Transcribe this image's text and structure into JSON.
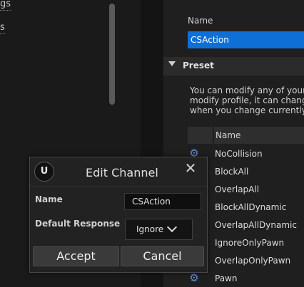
{
  "left_panel": {
    "items": [
      "gs",
      "s"
    ]
  },
  "details": {
    "name_label": "Name",
    "name_value": "CSAction",
    "preset_title": "Preset",
    "preset_description": [
      "You can modify any of your p",
      "modify profile, it can change",
      "when you change currently d"
    ],
    "table_header": "Name",
    "profiles": [
      "NoCollision",
      "BlockAll",
      "OverlapAll",
      "BlockAllDynamic",
      "OverlapAllDynamic",
      "IgnoreOnlyPawn",
      "OverlapOnlyPawn",
      "Pawn"
    ],
    "accent_color": "#0e6fd6"
  },
  "dialog": {
    "logo_text": "U",
    "title": "Edit Channel",
    "close_glyph": "✕",
    "name_label": "Name",
    "name_value": "CSAction",
    "default_response_label": "Default Response",
    "default_response_value": "Ignore",
    "accept_label": "Accept",
    "cancel_label": "Cancel"
  },
  "icons": {
    "profile_icon": "gear-icon",
    "gear_glyph": "⚙"
  }
}
